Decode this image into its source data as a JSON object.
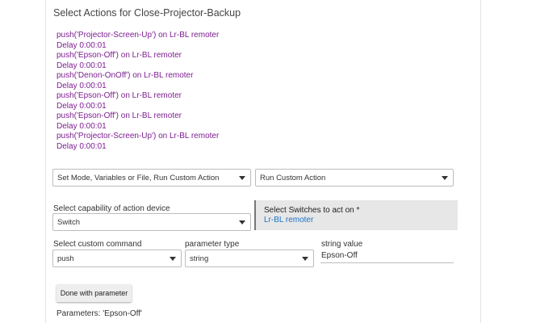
{
  "title": "Select Actions for Close-Projector-Backup",
  "actions": [
    "push('Projector-Screen-Up') on Lr-BL remoter",
    "Delay 0:00:01",
    "push('Epson-Off') on Lr-BL remoter",
    "Delay 0:00:01",
    "push('Denon-OnOff') on Lr-BL remoter",
    "Delay 0:00:01",
    "push('Epson-Off') on Lr-BL remoter",
    "Delay 0:00:01",
    "push('Epson-Off') on Lr-BL remoter",
    "Delay 0:00:01",
    "push('Projector-Screen-Up') on Lr-BL remoter",
    "Delay 0:00:01"
  ],
  "action_category": {
    "value": "Set Mode, Variables or File, Run Custom Action"
  },
  "action_type": {
    "value": "Run Custom Action"
  },
  "capability": {
    "label": "Select capability of action device",
    "value": "Switch"
  },
  "switches": {
    "label": "Select Switches to act on *",
    "value": "Lr-BL remoter"
  },
  "custom_command": {
    "label": "Select custom command",
    "value": "push"
  },
  "parameter_type": {
    "label": "parameter type",
    "value": "string"
  },
  "string_value": {
    "label": "string value",
    "value": "Epson-Off"
  },
  "done_button": {
    "label": "Done with parameter"
  },
  "parameters_text": "Parameters: 'Epson-Off'",
  "colors": {
    "action_text": "#7d1e90",
    "link": "#1a73c8"
  }
}
